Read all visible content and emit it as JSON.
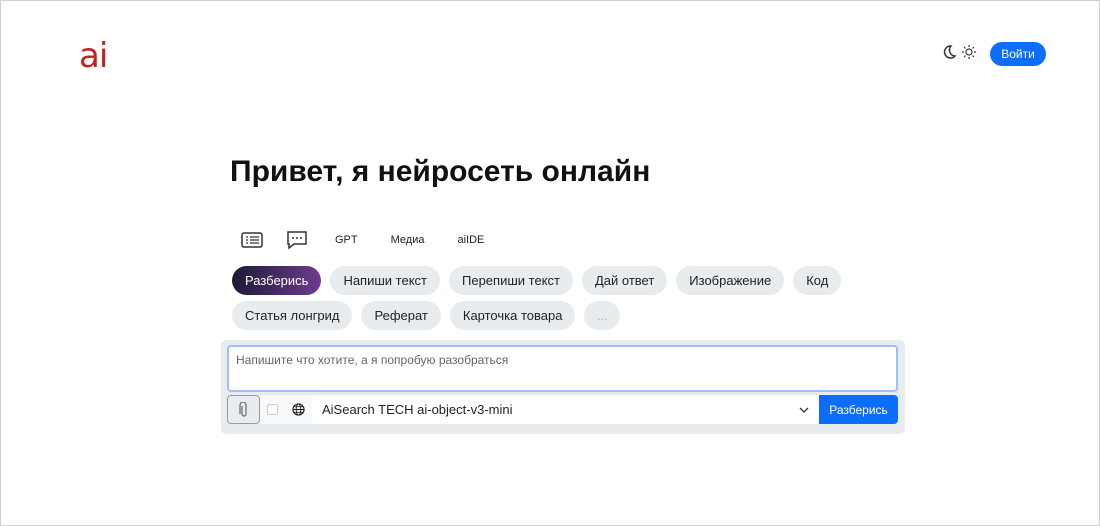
{
  "header": {
    "logo": "ai",
    "login_label": "Войти"
  },
  "main": {
    "title": "Привет, я нейросеть онлайн",
    "tabs": [
      "GPT",
      "Медиа",
      "aiIDE"
    ],
    "chips_row1": [
      "Разберись",
      "Напиши текст",
      "Перепиши текст",
      "Дай ответ",
      "Изображение",
      "Код"
    ],
    "chips_row2": [
      "Статья лонгрид",
      "Реферат",
      "Карточка товара",
      "..."
    ],
    "input": {
      "placeholder": "Напишите что хотите, а я попробую разобраться",
      "value": ""
    },
    "model_select": "AiSearch TECH ai-object-v3-mini",
    "submit_label": "Разберись"
  }
}
